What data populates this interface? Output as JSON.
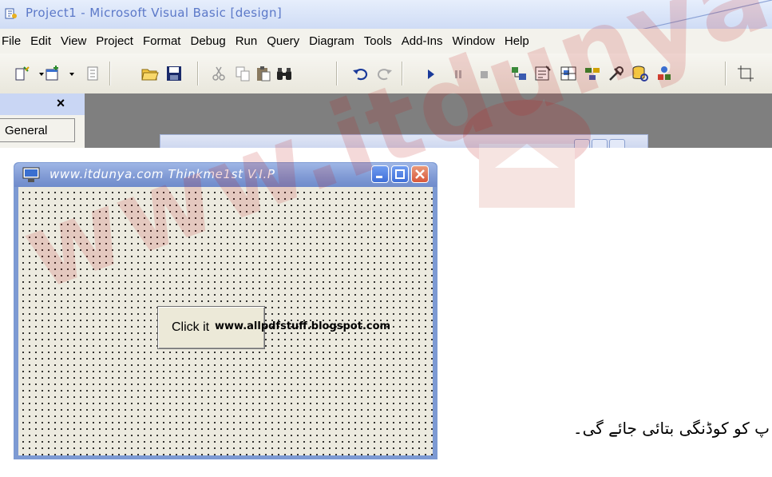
{
  "ide": {
    "title": "Project1 - Microsoft Visual Basic [design]",
    "menu": [
      "File",
      "Edit",
      "View",
      "Project",
      "Format",
      "Debug",
      "Run",
      "Query",
      "Diagram",
      "Tools",
      "Add-Ins",
      "Window",
      "Help"
    ]
  },
  "toolbox": {
    "close_label": "×",
    "general_label": "General"
  },
  "form": {
    "title": "www.itdunya.com  Thinkme1st V.I.P",
    "button_caption": "Click it",
    "overlay_url": "www.allpdfstuff.blogspot.com"
  },
  "watermark": {
    "text": "www.itdunya.com"
  },
  "urdu_caption": "پ کو کوڈنگی بتائی جائے گی۔",
  "colors": {
    "form_titlebar": "#7f99d4",
    "close_button": "#d8573a",
    "watermark": "#c11c1c"
  }
}
